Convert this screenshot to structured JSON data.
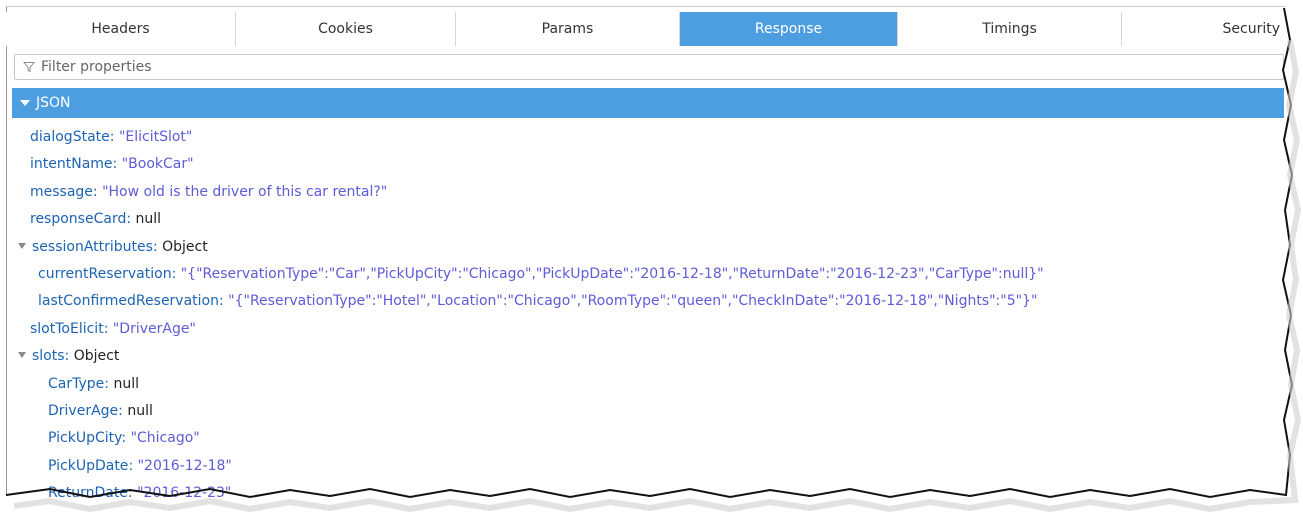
{
  "tabs": [
    {
      "label": "Headers",
      "active": false
    },
    {
      "label": "Cookies",
      "active": false
    },
    {
      "label": "Params",
      "active": false
    },
    {
      "label": "Response",
      "active": true
    },
    {
      "label": "Timings",
      "active": false
    },
    {
      "label": "Security",
      "active": false
    }
  ],
  "filter": {
    "placeholder": "Filter properties",
    "icon": "funnel-icon"
  },
  "json_section": {
    "label": "JSON",
    "expanded": true
  },
  "tree": {
    "dialogState": {
      "key": "dialogState",
      "value": "\"ElicitSlot\""
    },
    "intentName": {
      "key": "intentName",
      "value": "\"BookCar\""
    },
    "message": {
      "key": "message",
      "value": "\"How old is the driver of this car rental?\""
    },
    "responseCard": {
      "key": "responseCard",
      "value": "null"
    },
    "sessionAttributes": {
      "key": "sessionAttributes",
      "value": "Object",
      "children": {
        "currentReservation": {
          "key": "currentReservation",
          "value": "\"{\"ReservationType\":\"Car\",\"PickUpCity\":\"Chicago\",\"PickUpDate\":\"2016-12-18\",\"ReturnDate\":\"2016-12-23\",\"CarType\":null}\""
        },
        "lastConfirmedReservation": {
          "key": "lastConfirmedReservation",
          "value": "\"{\"ReservationType\":\"Hotel\",\"Location\":\"Chicago\",\"RoomType\":\"queen\",\"CheckInDate\":\"2016-12-18\",\"Nights\":\"5\"}\""
        }
      }
    },
    "slotToElicit": {
      "key": "slotToElicit",
      "value": "\"DriverAge\""
    },
    "slots": {
      "key": "slots",
      "value": "Object",
      "children": {
        "CarType": {
          "key": "CarType",
          "value": "null"
        },
        "DriverAge": {
          "key": "DriverAge",
          "value": "null"
        },
        "PickUpCity": {
          "key": "PickUpCity",
          "value": "\"Chicago\""
        },
        "PickUpDate": {
          "key": "PickUpDate",
          "value": "\"2016-12-18\""
        },
        "ReturnDate": {
          "key": "ReturnDate",
          "value": "\"2016-12-23\""
        }
      }
    }
  },
  "colors": {
    "accent": "#4d9ee0",
    "key": "#1d63b4",
    "string": "#5e5cd6"
  }
}
